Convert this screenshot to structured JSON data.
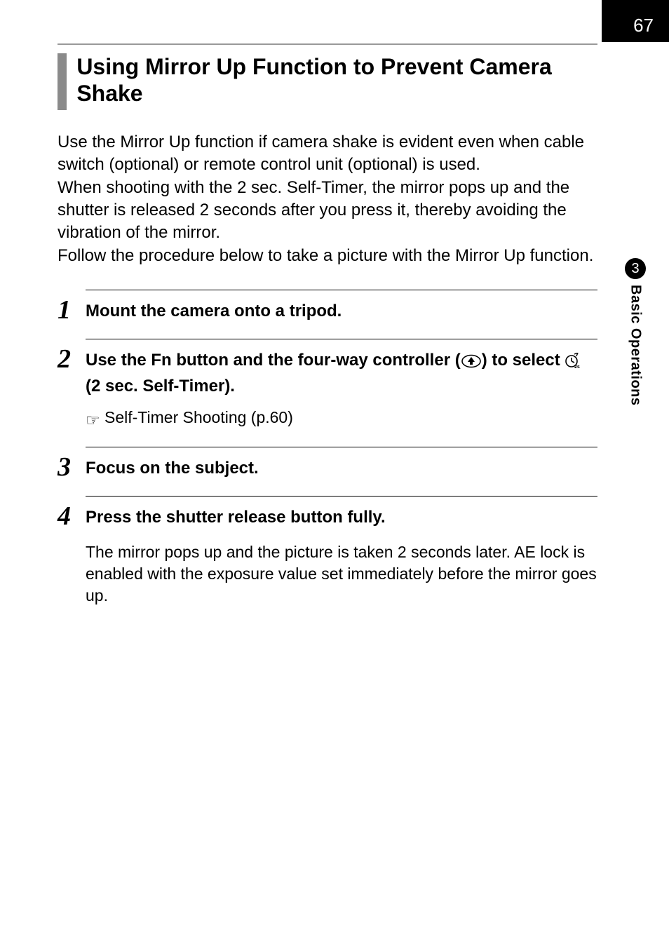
{
  "page_number": "67",
  "side_tab": {
    "chapter_number": "3",
    "label": "Basic Operations"
  },
  "heading": "Using Mirror Up Function to Prevent Camera Shake",
  "intro": {
    "p1": "Use the Mirror Up function if camera shake is evident even when cable switch (optional) or remote control unit (optional) is used.",
    "p2": "When shooting with the 2 sec. Self-Timer, the mirror pops up and the shutter is released 2 seconds after you press it, thereby avoiding the vibration of the mirror.",
    "p3": "Follow the procedure below to take a picture with the Mirror Up function."
  },
  "steps": {
    "s1": {
      "num": "1",
      "title": "Mount the camera onto a tripod."
    },
    "s2": {
      "num": "2",
      "title_a": "Use the ",
      "fn": "Fn",
      "title_b": " button and the four-way controller (",
      "title_c": ") to select ",
      "title_d": " (2 sec. Self-Timer).",
      "note_a": " Self-Timer Shooting (p.60)",
      "icon_up": "up-arrow-in-oval-icon",
      "icon_timer": "self-timer-2s-icon",
      "icon_hand": "pointing-hand-icon"
    },
    "s3": {
      "num": "3",
      "title": "Focus on the subject."
    },
    "s4": {
      "num": "4",
      "title": "Press the shutter release button fully.",
      "desc": "The mirror pops up and the picture is taken 2 seconds later. AE lock is enabled with the exposure value set immediately before the mirror goes up."
    }
  }
}
